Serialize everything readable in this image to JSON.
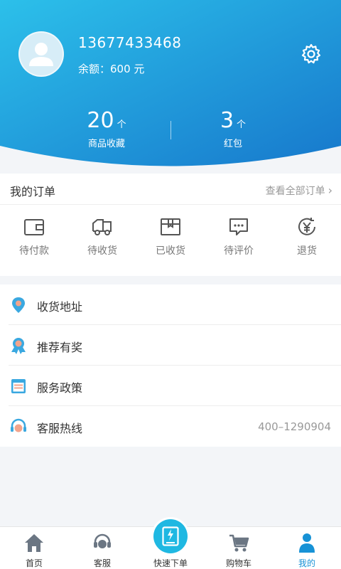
{
  "profile": {
    "phone": "13677433468",
    "balance": "余额：600 元"
  },
  "stats": {
    "favorites": {
      "value": "20",
      "unit": "个",
      "label": "商品收藏"
    },
    "red_packets": {
      "value": "3",
      "unit": "个",
      "label": "红包"
    }
  },
  "orders": {
    "title": "我的订单",
    "view_all": "查看全部订单",
    "items": [
      {
        "label": "待付款",
        "icon": "wallet-icon"
      },
      {
        "label": "待收货",
        "icon": "truck-icon"
      },
      {
        "label": "已收货",
        "icon": "package-icon"
      },
      {
        "label": "待评价",
        "icon": "comment-icon"
      },
      {
        "label": "退货",
        "icon": "refund-icon"
      }
    ]
  },
  "menu": [
    {
      "label": "收货地址",
      "icon": "location-icon"
    },
    {
      "label": "推荐有奖",
      "icon": "award-icon"
    },
    {
      "label": "服务政策",
      "icon": "policy-icon"
    },
    {
      "label": "客服热线",
      "icon": "headset-icon",
      "value": "400–1290904"
    }
  ],
  "tabs": [
    {
      "label": "首页",
      "icon": "home-icon"
    },
    {
      "label": "客服",
      "icon": "headset-icon"
    },
    {
      "label": "快速下单",
      "icon": "quick-order-icon"
    },
    {
      "label": "购物车",
      "icon": "cart-icon"
    },
    {
      "label": "我的",
      "icon": "user-icon",
      "active": true
    }
  ],
  "colors": {
    "header_start": "#29b8e6",
    "header_end": "#1a7fd0",
    "accent": "#1792d6",
    "menu_icon_blue": "#3aa8e0",
    "menu_icon_orange": "#f2a48c"
  }
}
